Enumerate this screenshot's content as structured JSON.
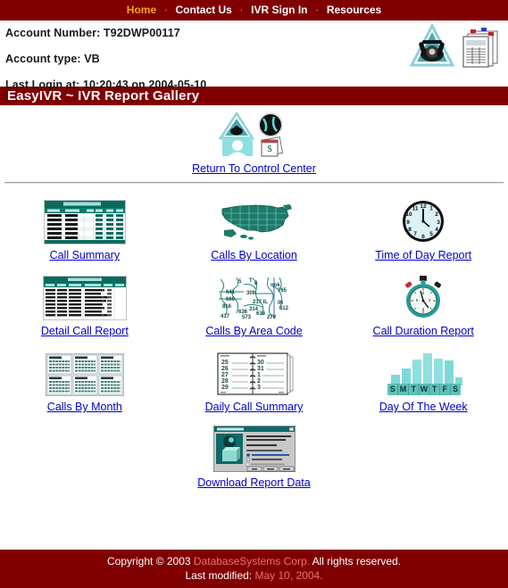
{
  "nav": {
    "separator": "·",
    "items": [
      {
        "label": "Home",
        "active": true
      },
      {
        "label": "Contact Us",
        "active": false
      },
      {
        "label": "IVR Sign In",
        "active": false
      },
      {
        "label": "Resources",
        "active": false
      }
    ]
  },
  "account": {
    "number_line": "Account Number: T92DWP00117",
    "type_line": "Account type: VB",
    "login_line": "Last Login at: 10:20:43 on 2004-05-10",
    "icons": [
      "telephone-icon",
      "report-papers-icon"
    ]
  },
  "title_bar": {
    "text": "EasyIVR ~ IVR Report Gallery"
  },
  "return_section": {
    "link_label": "Return To Control Center",
    "icons": [
      "control-center-icon",
      "globe-icon",
      "person-icon",
      "money-cards-icon"
    ]
  },
  "gallery": {
    "rows": [
      [
        {
          "label": "Call Summary",
          "icon": "call-summary-table-thumb"
        },
        {
          "label": "Calls By Location",
          "icon": "usa-map-thumb"
        },
        {
          "label": "Time of Day Report",
          "icon": "clock-thumb"
        }
      ],
      [
        {
          "label": "Detail Call Report",
          "icon": "detail-call-table-thumb"
        },
        {
          "label": "Calls By Area Code",
          "icon": "area-code-map-thumb"
        },
        {
          "label": "Call Duration Report",
          "icon": "stopwatch-thumb"
        }
      ],
      [
        {
          "label": "Calls By Month",
          "icon": "calendar-months-thumb"
        },
        {
          "label": "Daily Call Summary",
          "icon": "planner-book-thumb"
        },
        {
          "label": "Day Of The Week",
          "icon": "bar-chart-week-thumb"
        }
      ]
    ],
    "last_row": [
      {
        "label": "Download Report Data",
        "icon": "download-dialog-thumb"
      }
    ]
  },
  "thumbnails": {
    "call_summary": {
      "title": "Call Summary Report",
      "header_color": "#0a6a5e",
      "row_count": 7
    },
    "detail_call": {
      "title": "Detail Call Report",
      "header_color": "#0a6a5e",
      "row_count": 11
    },
    "daily_planner": {
      "left_numbers": [
        "25",
        "26",
        "27",
        "28",
        "29"
      ],
      "right_numbers": [
        "30",
        "31",
        "1",
        "2",
        "3"
      ]
    },
    "area_codes": [
      "5",
      "8",
      "641",
      "660",
      "816",
      "309",
      "217 IL",
      "314",
      "618",
      "636",
      "417",
      "573",
      "270",
      "812",
      "IN"
    ],
    "clock": {
      "hour": 11,
      "minute": 1
    }
  },
  "chart_data": {
    "type": "bar",
    "title": "Day Of The Week",
    "categories": [
      "S",
      "M",
      "T",
      "W",
      "T",
      "F",
      "S"
    ],
    "values": [
      30,
      48,
      72,
      100,
      82,
      78,
      22
    ],
    "xlabel": "",
    "ylabel": "",
    "ylim": [
      0,
      100
    ],
    "grid": false,
    "legend": "none",
    "bar_color": "#7fd8d8"
  },
  "footer": {
    "copyright_prefix": "Copyright © 2003 ",
    "company": "DatabaseSystems Corp.",
    "copyright_suffix": " All rights reserved.",
    "modified_prefix": "Last modified: ",
    "modified_date": "May 10, 2004."
  },
  "colors": {
    "brand_dark_red": "#800000",
    "nav_active": "#f0a818",
    "link_blue": "#0000cc",
    "accent_teal": "#0a6a5e",
    "footer_highlight": "#e87070"
  }
}
